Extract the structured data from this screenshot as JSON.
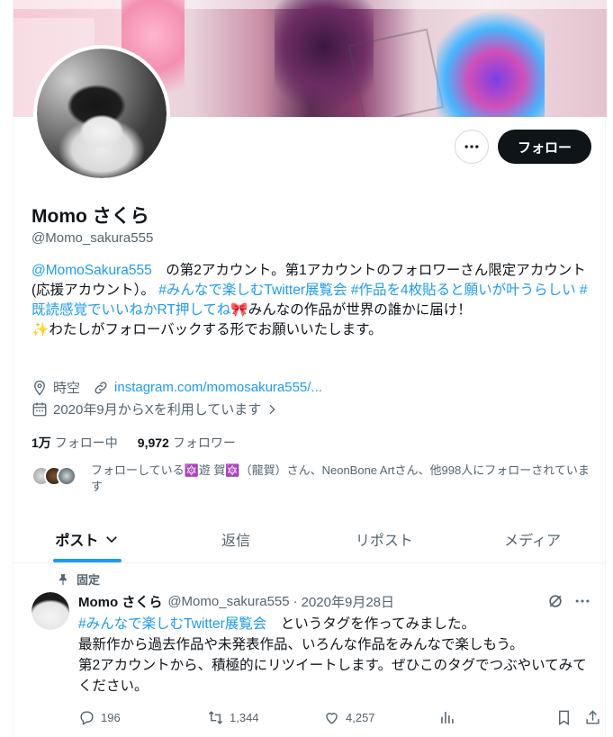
{
  "profile": {
    "name": "Momo さくら",
    "handle": "@Momo_sakura555",
    "follow_label": "フォロー",
    "bio": {
      "mention": "@MomoSakura555",
      "line1_rest": "　の第2アカウント。第1アカウントのフォロワーさん限定アカウント(応援アカウント）。",
      "tag1": "#みんなで楽しむTwitter展覧会",
      "tag2": "#作品を4枚貼ると願いが叶うらしい",
      "tag3": "#既読感覚でいいねかRT押してね",
      "ribbon": "🎀",
      "after_tags": "みんなの作品が世界の誰かに届け！",
      "sparkle": "✨",
      "last_line": "わたしがフォローバックする形でお願いいたします。"
    },
    "location": "時空",
    "website": "instagram.com/momosakura555/...",
    "joined": "2020年9月からXを利用しています",
    "following_count": "1万",
    "following_label": "フォロー中",
    "followers_count": "9,972",
    "followers_label": "フォロワー",
    "known_followers": "フォローしている🔯遊 賀🔯（龍賀）さん、NeonBone Artさん、他998人にフォローされています"
  },
  "tabs": [
    {
      "label": "ポスト"
    },
    {
      "label": "返信"
    },
    {
      "label": "リポスト"
    },
    {
      "label": "メディア"
    }
  ],
  "pinned_tweet": {
    "pinned_label": "固定",
    "name": "Momo さくら",
    "handle": "@Momo_sakura555",
    "date": "2020年9月28日",
    "tag": "#みんなで楽しむTwitter展覧会",
    "line1_rest": "　というタグを作ってみました。",
    "line2": "最新作から過去作品や未発表作品、いろんな作品をみんなで楽しもう。",
    "line3": "第2アカウントから、積極的にリツイートします。ぜひこのタグでつぶやいてみてください。",
    "replies": "196",
    "reposts": "1,344",
    "likes": "4,257"
  },
  "colors": {
    "accent": "#1d9bf0",
    "text": "#0f1419",
    "muted": "#536471",
    "follow_button_bg": "#0f1419"
  }
}
